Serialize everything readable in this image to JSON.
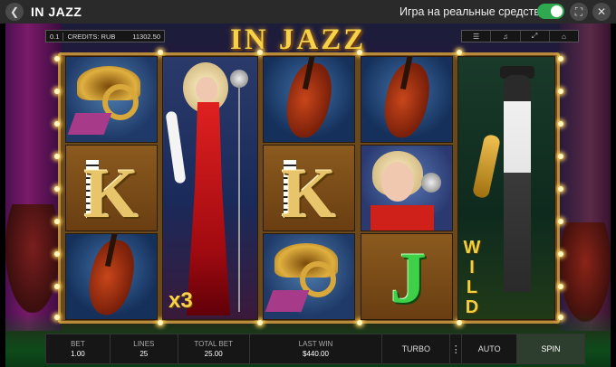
{
  "topbar": {
    "title": "IN JAZZ",
    "real_money_label": "Игра на реальные средства",
    "real_money_enabled": true,
    "icons": [
      "back-icon",
      "fullscreen-icon",
      "close-icon"
    ]
  },
  "game": {
    "logo": "IN JAZZ",
    "credits": {
      "bet": "0.1",
      "label": "CREDITS: RUB",
      "value": "11302.50"
    },
    "menu_icons": [
      "menu-icon",
      "sound-icon",
      "fullscreen-icon",
      "home-icon"
    ],
    "reels": [
      [
        "horn",
        "K",
        "cello"
      ],
      [
        "lady-tall"
      ],
      [
        "cello",
        "K",
        "horn"
      ],
      [
        "cello",
        "lady",
        "J"
      ],
      [
        "saxophonist-wild"
      ]
    ],
    "multiplier": "x3",
    "wild_label": "WILD",
    "colors": {
      "accent_gold": "#f6d24a",
      "frame": "#6a4a1c",
      "toggle": "#2fa84f"
    }
  },
  "bottom": {
    "bet_label": "BET",
    "bet_value": "1.00",
    "lines_label": "LINES",
    "lines_value": "25",
    "total_bet_label": "TOTAL BET",
    "total_bet_value": "25.00",
    "last_win_label": "LAST WIN",
    "last_win_value": "$440.00",
    "turbo_label": "TURBO",
    "auto_label": "AUTO",
    "spin_label": "SPIN"
  }
}
